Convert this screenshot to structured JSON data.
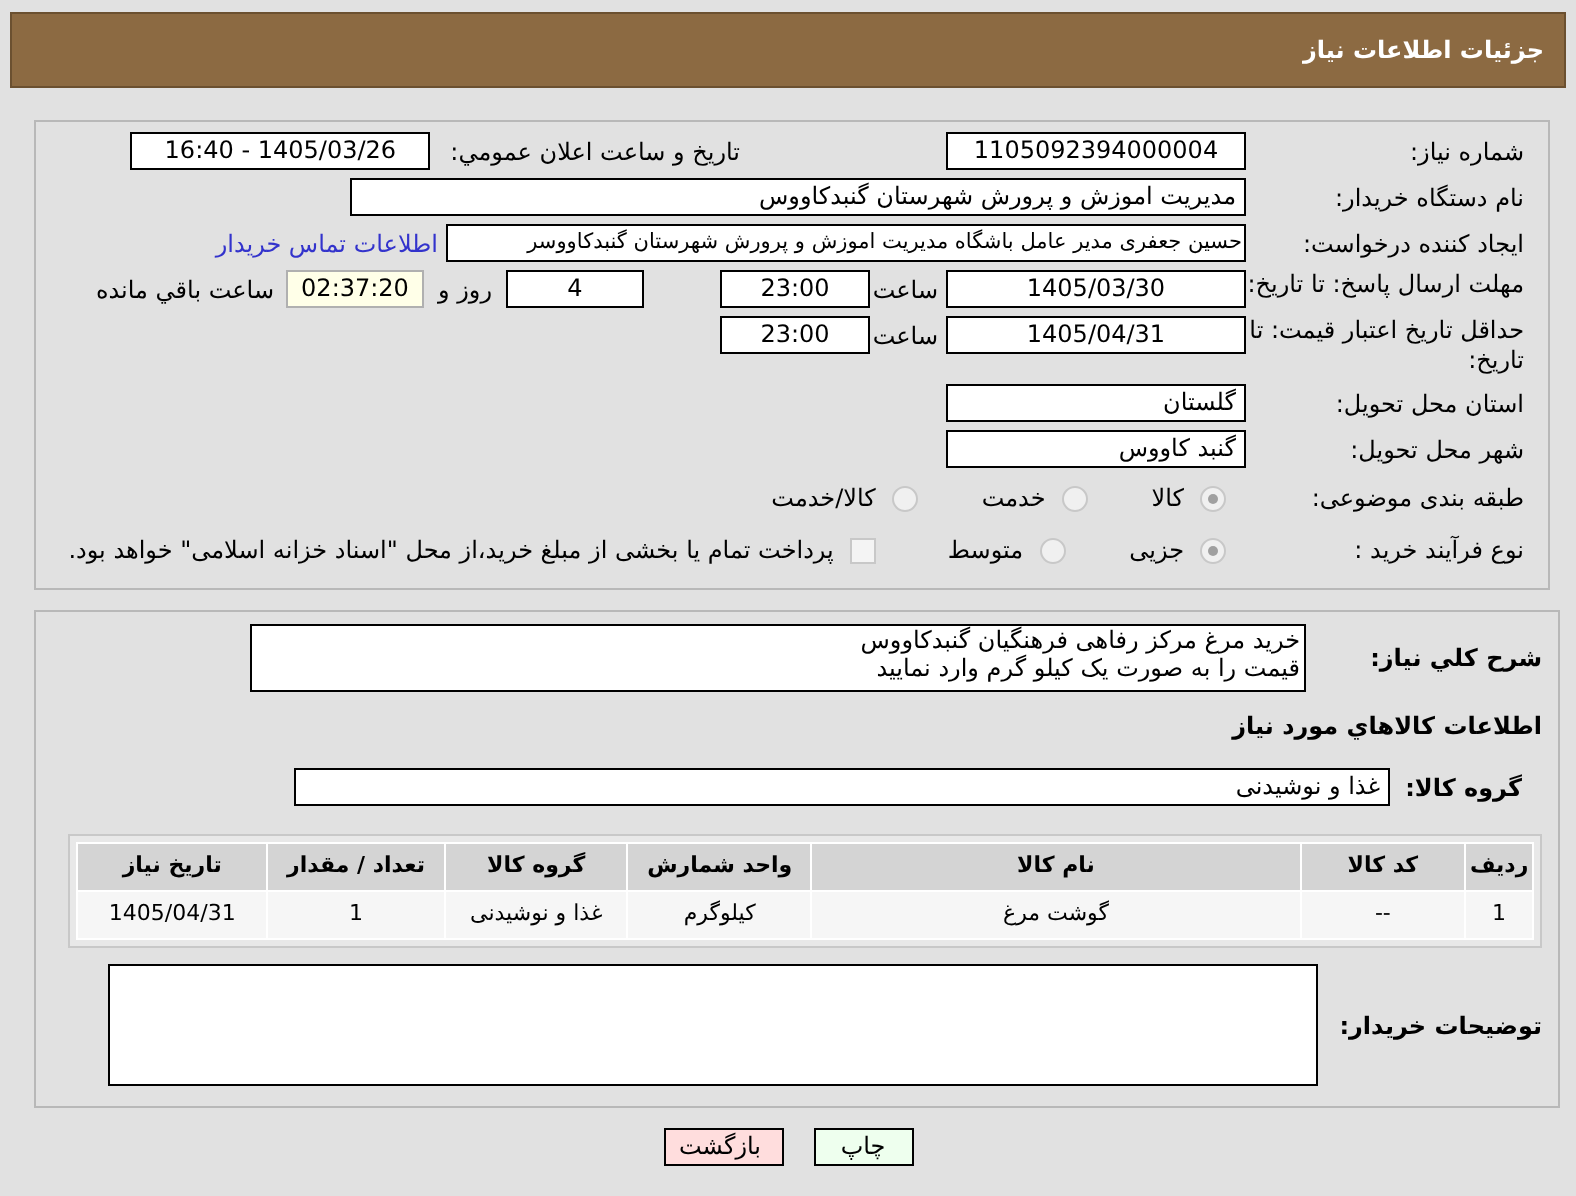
{
  "header": {
    "title": "جزئیات اطلاعات نیاز"
  },
  "fields": {
    "need_number": {
      "label": "شماره نیاز:",
      "value": "1105092394000004"
    },
    "announce": {
      "label": "تاریخ و ساعت اعلان عمومي:",
      "value": "1405/03/26 - 16:40"
    },
    "buyer": {
      "label": "نام دستگاه خریدار:",
      "value": "مدیریت اموزش و پرورش شهرستان گنبدکاووس"
    },
    "creator": {
      "label": "ایجاد کننده درخواست:",
      "value": "حسین جعفری مدیر عامل باشگاه مدیریت اموزش و پرورش شهرستان گنبدکاووسر",
      "link": "اطلاعات تماس خریدار"
    },
    "deadline": {
      "label": "مهلت ارسال پاسخ: تا تاریخ:",
      "date": "1405/03/30",
      "time_label": "ساعت",
      "time": "23:00",
      "days": "4",
      "days_label": "روز و",
      "remaining": "02:37:20",
      "remaining_label": "ساعت باقي مانده"
    },
    "validity": {
      "label": "حداقل تاریخ اعتبار قیمت: تا تاریخ:",
      "date": "1405/04/31",
      "time_label": "ساعت",
      "time": "23:00"
    },
    "province": {
      "label": "استان محل تحویل:",
      "value": "گلستان"
    },
    "city": {
      "label": "شهر محل تحویل:",
      "value": "گنبد کاووس"
    }
  },
  "category": {
    "label": "طبقه بندی موضوعی:",
    "options": [
      {
        "label": "کالا",
        "selected": true
      },
      {
        "label": "خدمت",
        "selected": false
      },
      {
        "label": "کالا/خدمت",
        "selected": false
      }
    ]
  },
  "process": {
    "label": "نوع فرآیند خرید :",
    "options": [
      {
        "label": "جزیی",
        "selected": true
      },
      {
        "label": "متوسط",
        "selected": false
      }
    ],
    "treasury": {
      "label": "پرداخت تمام یا بخشی از مبلغ خرید،از محل \"اسناد خزانه اسلامی\" خواهد بود.",
      "checked": false
    }
  },
  "description": {
    "label": "شرح کلي نیاز:",
    "lines": [
      "خرید مرغ مرکز رفاهی فرهنگیان گنبدکاووس",
      "قیمت را به صورت یک کیلو گرم وارد نمایید"
    ]
  },
  "goods_heading": "اطلاعات کالاهاي مورد نیاز",
  "goods_group": {
    "label": "گروه کالا:",
    "value": "غذا و نوشیدنی"
  },
  "table": {
    "columns": [
      "ردیف",
      "کد کالا",
      "نام کالا",
      "واحد شمارش",
      "گروه کالا",
      "تعداد / مقدار",
      "تاریخ نیاز"
    ],
    "rows": [
      [
        "1",
        "--",
        "گوشت مرغ",
        "کیلوگرم",
        "غذا و نوشیدنی",
        "1",
        "1405/04/31"
      ]
    ]
  },
  "buyer_notes": {
    "label": "توضیحات خریدار:"
  },
  "buttons": [
    {
      "label": "چاپ",
      "kind": "print"
    },
    {
      "label": "بازگشت",
      "kind": "back"
    }
  ]
}
